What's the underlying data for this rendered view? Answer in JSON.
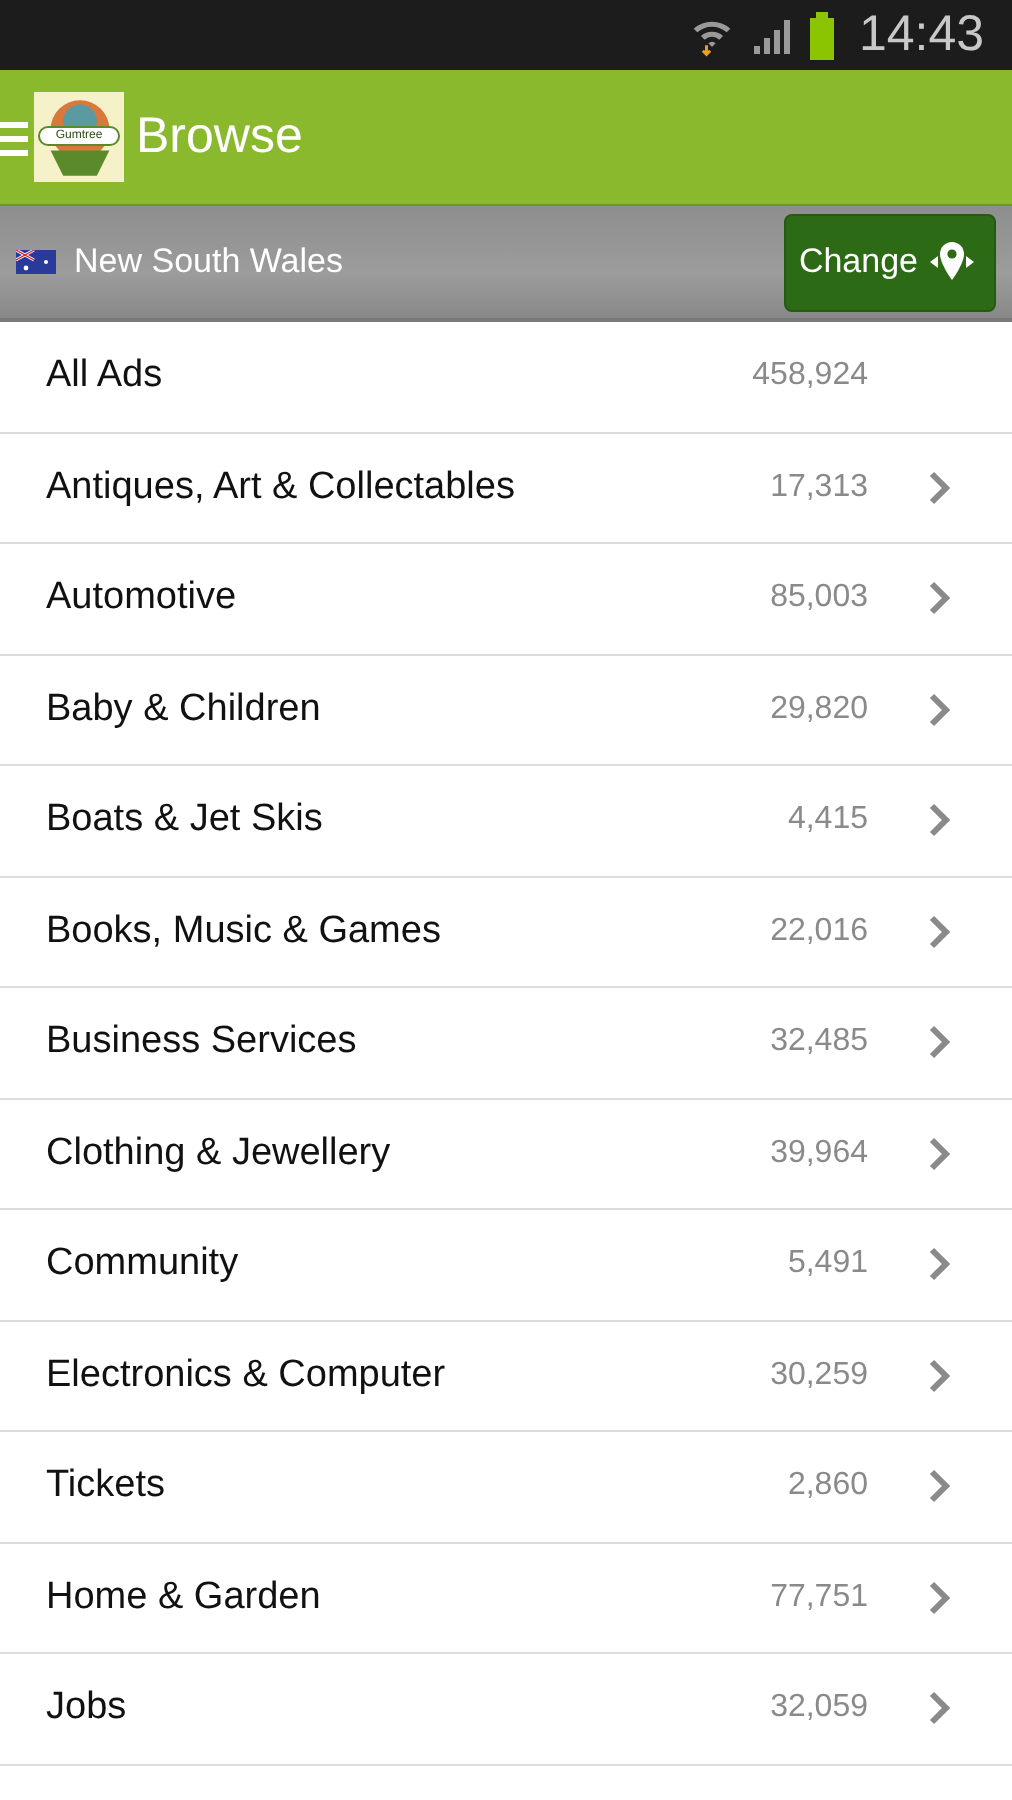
{
  "status_bar": {
    "time": "14:43"
  },
  "app_bar": {
    "logo_text": "Gumtree",
    "title": "Browse"
  },
  "location": {
    "name": "New South Wales",
    "button": "Change"
  },
  "categories": [
    {
      "name": "All Ads",
      "count": "458,924",
      "chevron": false
    },
    {
      "name": "Antiques, Art & Collectables",
      "count": "17,313",
      "chevron": true
    },
    {
      "name": "Automotive",
      "count": "85,003",
      "chevron": true
    },
    {
      "name": "Baby & Children",
      "count": "29,820",
      "chevron": true
    },
    {
      "name": "Boats & Jet Skis",
      "count": "4,415",
      "chevron": true
    },
    {
      "name": "Books, Music & Games",
      "count": "22,016",
      "chevron": true
    },
    {
      "name": "Business Services",
      "count": "32,485",
      "chevron": true
    },
    {
      "name": "Clothing & Jewellery",
      "count": "39,964",
      "chevron": true
    },
    {
      "name": "Community",
      "count": "5,491",
      "chevron": true
    },
    {
      "name": "Electronics & Computer",
      "count": "30,259",
      "chevron": true
    },
    {
      "name": "Tickets",
      "count": "2,860",
      "chevron": true
    },
    {
      "name": "Home & Garden",
      "count": "77,751",
      "chevron": true
    },
    {
      "name": "Jobs",
      "count": "32,059",
      "chevron": true
    }
  ]
}
